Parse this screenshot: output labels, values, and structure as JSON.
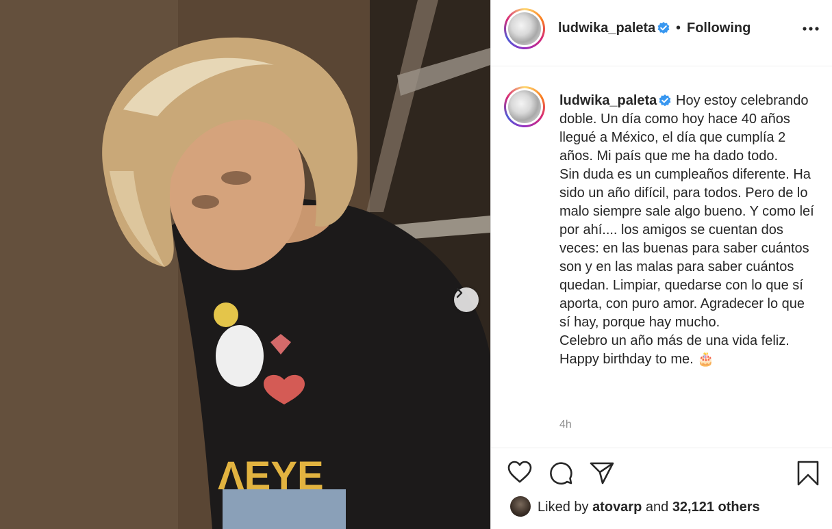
{
  "post": {
    "username": "ludwika_paleta",
    "verified": true,
    "separator": "•",
    "follow_status": "Following",
    "more_icon": "more-options-icon",
    "caption": "Hoy estoy celebrando doble. Un día como hoy hace 40 años llegué a México, el día que cumplía 2 años. Mi país que me ha dado todo.\nSin duda es un cumpleaños diferente. Ha sido un año difícil, para todos. Pero de lo malo siempre sale algo bueno. Y como leí por ahí.... los amigos se cuentan dos veces: en las buenas para saber cuántos son y en las malas para saber cuántos quedan. Limpiar, quedarse con lo que sí aporta, con puro amor. Agradecer lo que sí hay, porque hay mucho.\nCelebro un año más de una vida feliz.\nHappy birthday to me. 🎂",
    "timestamp": "4h"
  },
  "likes": {
    "prefix": "Liked by",
    "user": "atovarp",
    "and": "and",
    "others": "32,121 others"
  },
  "icons": {
    "like": "heart-icon",
    "comment": "comment-icon",
    "share": "paper-plane-icon",
    "save": "bookmark-icon",
    "next": "chevron-right-icon"
  },
  "colors": {
    "text": "#262626",
    "muted": "#8e8e8e",
    "verified": "#3897f0",
    "border": "#dbdbdb"
  }
}
